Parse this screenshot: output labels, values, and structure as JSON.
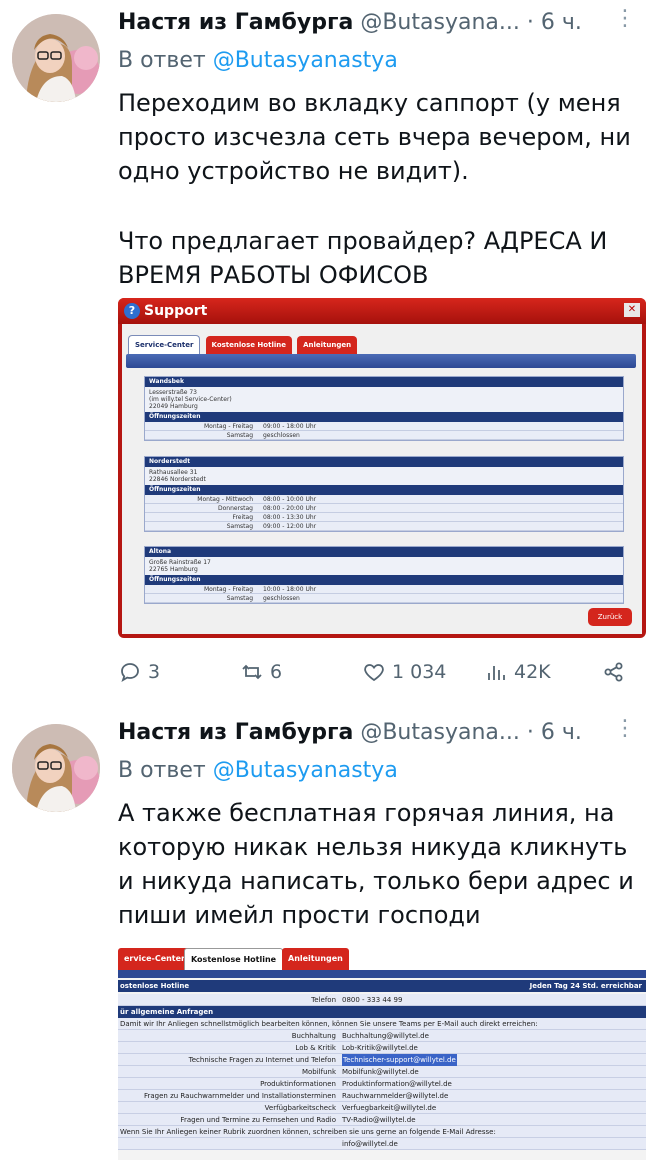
{
  "tweets": [
    {
      "name": "Настя из Гамбурга",
      "handle": "@Butasyana...",
      "time": "· 6 ч.",
      "reply_prefix": "В ответ",
      "reply_mention": "@Butasyanastya",
      "text_1": "Переходим во вкладку саппорт (у меня просто изсчезла сеть вчера вечером, ни одно устройство не видит).",
      "text_2": "Что предлагает провайдер? АДРЕСА И ВРЕМЯ РАБОТЫ ОФИСОВ"
    },
    {
      "name": "Настя из Гамбурга",
      "handle": "@Butasyana...",
      "time": "· 6 ч.",
      "reply_prefix": "В ответ",
      "reply_mention": "@Butasyanastya",
      "text_1": "А также бесплатная горячая линия, на которую никак нельзя никуда кликнуть и никуда написать, только бери адрес и пиши имейл прости господи"
    }
  ],
  "actions": {
    "replies": "3",
    "retweets": "6",
    "likes": "1 034",
    "views": "42K"
  },
  "support_window": {
    "title": "Support",
    "tabs": [
      "Service-Center",
      "Kostenlose Hotline",
      "Anleitungen"
    ],
    "back_button": "Zurück",
    "offices": [
      {
        "name": "Wandsbek",
        "address": [
          "Lesserstraße 73",
          "(im willy.tel Service-Center)",
          "22049 Hamburg"
        ],
        "hours_label": "Öffnungszeiten",
        "hours": [
          {
            "days": "Montag - Freitag",
            "time": "09:00 - 18:00 Uhr"
          },
          {
            "days": "Samstag",
            "time": "geschlossen"
          }
        ]
      },
      {
        "name": "Norderstedt",
        "address": [
          "Rathausallee 31",
          "22846 Norderstedt"
        ],
        "hours_label": "Öffnungszeiten",
        "hours": [
          {
            "days": "Montag - Mittwoch",
            "time": "08:00 - 10:00 Uhr"
          },
          {
            "days": "Donnerstag",
            "time": "08:00 - 20:00 Uhr"
          },
          {
            "days": "Freitag",
            "time": "08:00 - 13:30 Uhr"
          },
          {
            "days": "Samstag",
            "time": "09:00 - 12:00 Uhr"
          }
        ]
      },
      {
        "name": "Altona",
        "address": [
          "Große Rainstraße 17",
          "22765 Hamburg"
        ],
        "hours_label": "Öffnungszeiten",
        "hours": [
          {
            "days": "Montag - Freitag",
            "time": "10:00 - 18:00 Uhr"
          },
          {
            "days": "Samstag",
            "time": "geschlossen"
          }
        ]
      }
    ]
  },
  "hotline_window": {
    "tabs": [
      "ervice-Center",
      "Kostenlose Hotline",
      "Anleitungen"
    ],
    "header_left": "ostenlose Hotline",
    "header_right": "Jeden Tag 24 Std. erreichbar",
    "phone_label": "Telefon",
    "phone_value": "0800 - 333 44 99",
    "section": "ür allgemeine Anfragen",
    "intro": "Damit wir Ihr Anliegen schnellstmöglich bearbeiten können, können Sie unsere Teams per E-Mail auch direkt erreichen:",
    "rows": [
      {
        "label": "Buchhaltung",
        "value": "Buchhaltung@willytel.de"
      },
      {
        "label": "Lob & Kritik",
        "value": "Lob-Kritik@willytel.de"
      },
      {
        "label": "Technische Fragen zu Internet und Telefon",
        "value": "Technischer-support@willytel.de"
      },
      {
        "label": "Mobilfunk",
        "value": "Mobilfunk@willytel.de"
      },
      {
        "label": "Produktinformationen",
        "value": "Produktinformation@willytel.de"
      },
      {
        "label": "Fragen zu Rauchwarnmelder und Installationsterminen",
        "value": "Rauchwarnmelder@willytel.de"
      },
      {
        "label": "Verfügbarkeitscheck",
        "value": "Verfuegbarkeit@willytel.de"
      },
      {
        "label": "Fragen und Termine zu Fernsehen und Radio",
        "value": "TV-Radio@willytel.de"
      }
    ],
    "footer_note": "Wenn Sie Ihr Anliegen keiner Rubrik zuordnen können, schreiben sie uns gerne an folgende E-Mail Adresse:",
    "footer_email": "info@willytel.de"
  }
}
